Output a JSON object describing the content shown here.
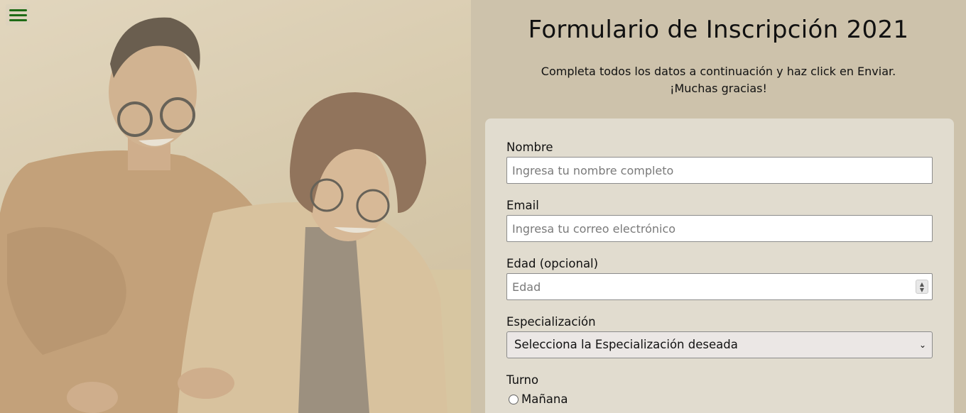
{
  "menu": {
    "icon": "hamburger-menu-icon"
  },
  "header": {
    "title": "Formulario de Inscripción 2021",
    "subtitle_line1": "Completa todos los datos a continuación y haz click en Enviar.",
    "subtitle_line2": "¡Muchas gracias!"
  },
  "form": {
    "nombre": {
      "label": "Nombre",
      "placeholder": "Ingresa tu nombre completo"
    },
    "email": {
      "label": "Email",
      "placeholder": "Ingresa tu correo electrónico"
    },
    "edad": {
      "label": "Edad (opcional)",
      "placeholder": "Edad"
    },
    "especializacion": {
      "label": "Especialización",
      "selected": "Selecciona la Especialización deseada"
    },
    "turno": {
      "label": "Turno",
      "options": [
        "Mañana"
      ]
    }
  },
  "colors": {
    "accent": "#1e6b15",
    "background": "#cdc2ab",
    "card": "#e1dccf"
  }
}
